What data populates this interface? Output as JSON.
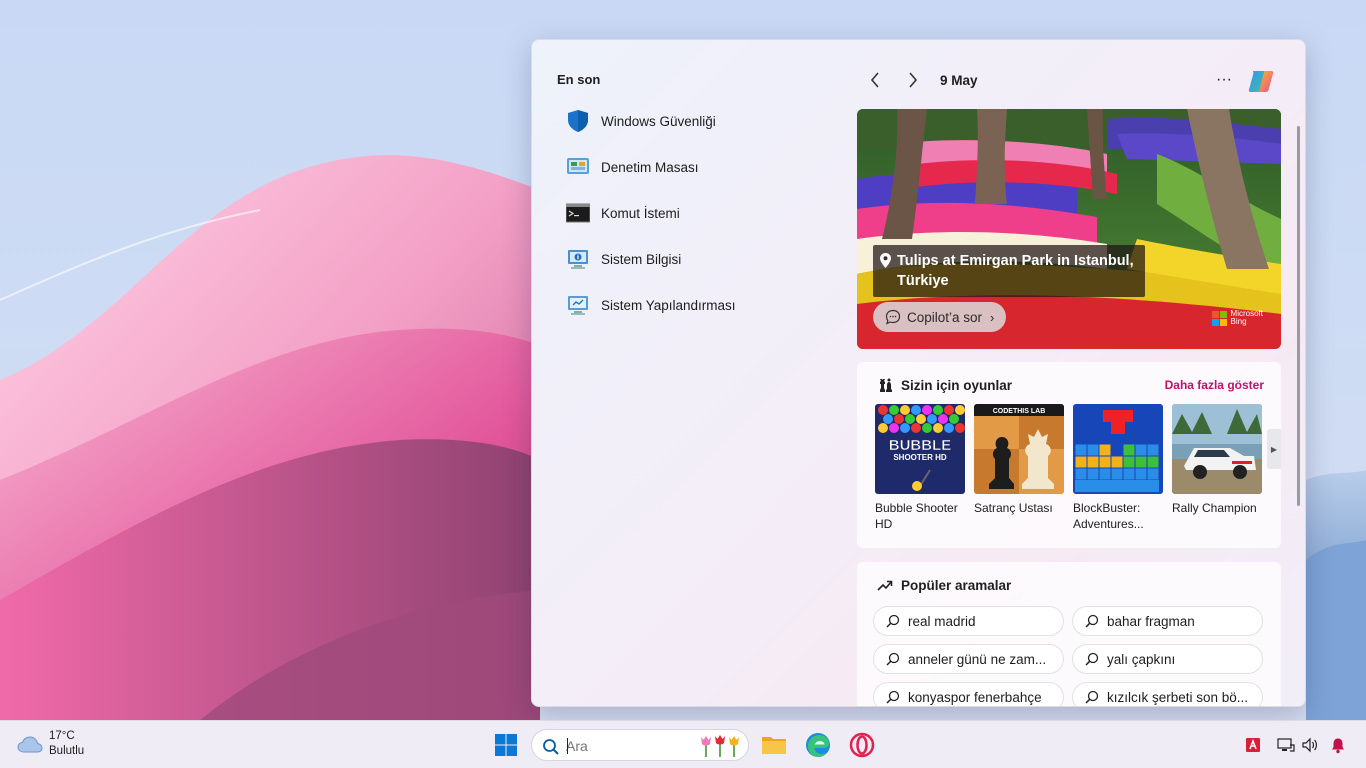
{
  "panel": {
    "recent_title": "En son",
    "recent_items": [
      {
        "label": "Windows Güvenliği",
        "icon": "shield-icon"
      },
      {
        "label": "Denetim Masası",
        "icon": "control-panel-icon"
      },
      {
        "label": "Komut İstemi",
        "icon": "terminal-icon"
      },
      {
        "label": "Sistem Bilgisi",
        "icon": "system-info-icon"
      },
      {
        "label": "Sistem Yapılandırması",
        "icon": "system-config-icon"
      }
    ],
    "nav": {
      "date": "9 May",
      "more": "···"
    },
    "hero": {
      "caption": "Tulips at Emirgan Park in Istanbul, Türkiye",
      "ask_label": "Copilot’a sor",
      "brand_line1": "Microsoft",
      "brand_line2": "Bing"
    },
    "games": {
      "title": "Sizin için oyunlar",
      "more_link": "Daha fazla göster",
      "items": [
        {
          "name": "Bubble Shooter HD",
          "thumb_text": "BUBBLE",
          "thumb_sub": "SHOOTER HD"
        },
        {
          "name": "Satranç Ustası",
          "thumb_text": "CODETHIS LAB"
        },
        {
          "name": "BlockBuster: Adventures..."
        },
        {
          "name": "Rally Champion"
        }
      ]
    },
    "popular": {
      "title": "Popüler aramalar",
      "items": [
        "real madrid",
        "bahar fragman",
        "anneler günü ne zam...",
        "yalı çapkını",
        "konyaspor fenerbahçe",
        "kızılcık şerbeti son bö..."
      ]
    }
  },
  "taskbar": {
    "weather": {
      "temp": "17°C",
      "condition": "Bulutlu"
    },
    "search_placeholder": "Ara"
  },
  "colors": {
    "accent_link": "#c0106f",
    "start_blue": "#0a78d4"
  }
}
